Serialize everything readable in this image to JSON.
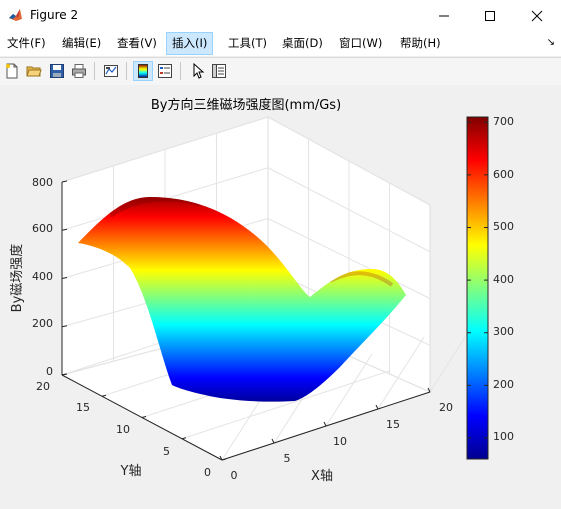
{
  "window": {
    "title": "Figure 2",
    "app_icon": "matlab-logo-icon"
  },
  "controls": [
    "minimize-icon",
    "maximize-icon",
    "close-icon"
  ],
  "menu": {
    "items": [
      "文件(F)",
      "编辑(E)",
      "查看(V)",
      "插入(I)",
      "工具(T)",
      "桌面(D)",
      "窗口(W)",
      "帮助(H)"
    ],
    "active_index": 3,
    "overflow_arrow": "↘"
  },
  "toolbar": {
    "buttons": [
      "new-figure-icon",
      "open-file-icon",
      "save-icon",
      "print-icon",
      "link-plot-icon",
      "insert-colorbar-icon",
      "insert-legend-icon",
      "edit-plot-pointer-icon",
      "property-inspector-icon"
    ],
    "pressed": "insert-colorbar-icon"
  },
  "chart_data": {
    "type": "surface",
    "title": "By方向三维磁场强度图(mm/Gs)",
    "xlabel": "X轴",
    "ylabel": "Y轴",
    "zlabel": "By磁场强度",
    "x_ticks": [
      "0",
      "5",
      "10",
      "15",
      "20"
    ],
    "y_ticks": [
      "0",
      "5",
      "10",
      "15",
      "20"
    ],
    "z_ticks": [
      "0",
      "200",
      "400",
      "600",
      "800"
    ],
    "xlim": [
      0,
      20
    ],
    "ylim": [
      0,
      20
    ],
    "zlim": [
      0,
      800
    ],
    "colormap": "jet",
    "colorbar": {
      "ticks": [
        "100",
        "200",
        "300",
        "400",
        "500",
        "600",
        "700"
      ],
      "clim": [
        60,
        710
      ]
    },
    "surface_description_values": {
      "x_profile_at_y20": [
        540,
        620,
        690,
        700,
        650,
        560,
        450,
        330,
        250,
        300,
        380,
        420,
        440,
        450,
        440,
        420,
        390,
        360,
        330,
        310,
        300
      ],
      "min_value": 60,
      "max_value": 705
    },
    "grid": true
  }
}
